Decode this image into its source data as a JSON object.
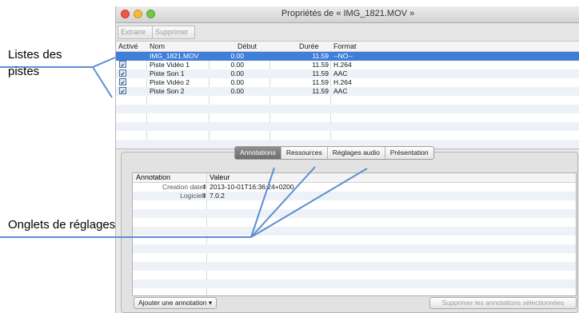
{
  "window": {
    "title": "Propriétés de « IMG_1821.MOV »"
  },
  "toolbar": {
    "extract_label": "Extraire",
    "delete_label": "Supprimer"
  },
  "tracks": {
    "columns": {
      "active": "Activé",
      "name": "Nom",
      "start": "Début",
      "duration": "Durée",
      "format": "Format"
    },
    "rows": [
      {
        "active": "",
        "name": "IMG_1821.MOV",
        "start": "0.00",
        "duration": "11.59",
        "format": "--NO--"
      },
      {
        "active": "✔",
        "name": "Piste Vidéo 1",
        "start": "0.00",
        "duration": "11.59",
        "format": "H.264"
      },
      {
        "active": "✔",
        "name": "Piste Son 1",
        "start": "0.00",
        "duration": "11.59",
        "format": "AAC"
      },
      {
        "active": "✔",
        "name": "Piste Vidéo 2",
        "start": "0.00",
        "duration": "11.59",
        "format": "H.264"
      },
      {
        "active": "✔",
        "name": "Piste Son 2",
        "start": "0.00",
        "duration": "11.59",
        "format": "AAC"
      }
    ]
  },
  "tabs": [
    {
      "label": "Annotations",
      "active": true
    },
    {
      "label": "Ressources",
      "active": false
    },
    {
      "label": "Réglages audio",
      "active": false
    },
    {
      "label": "Présentation",
      "active": false
    }
  ],
  "annotations": {
    "columns": {
      "annotation": "Annotation",
      "value": "Valeur"
    },
    "rows": [
      {
        "key": "Creation date",
        "value": "2013-10-01T16:36:24+0200"
      },
      {
        "key": "Logiciel",
        "value": "7.0.2"
      }
    ]
  },
  "buttons": {
    "add_annotation": "Ajouter une annotation",
    "delete_selected": "Supprimer les annotations sélectionnées"
  },
  "callouts": {
    "tracks_label_line1": "Listes des",
    "tracks_label_line2": "pistes",
    "tabs_label": "Onglets de réglages"
  },
  "colors": {
    "selection": "#3f7fd8",
    "callout_line": "#5b8fd4",
    "active_tab": "#7b7b7b"
  }
}
